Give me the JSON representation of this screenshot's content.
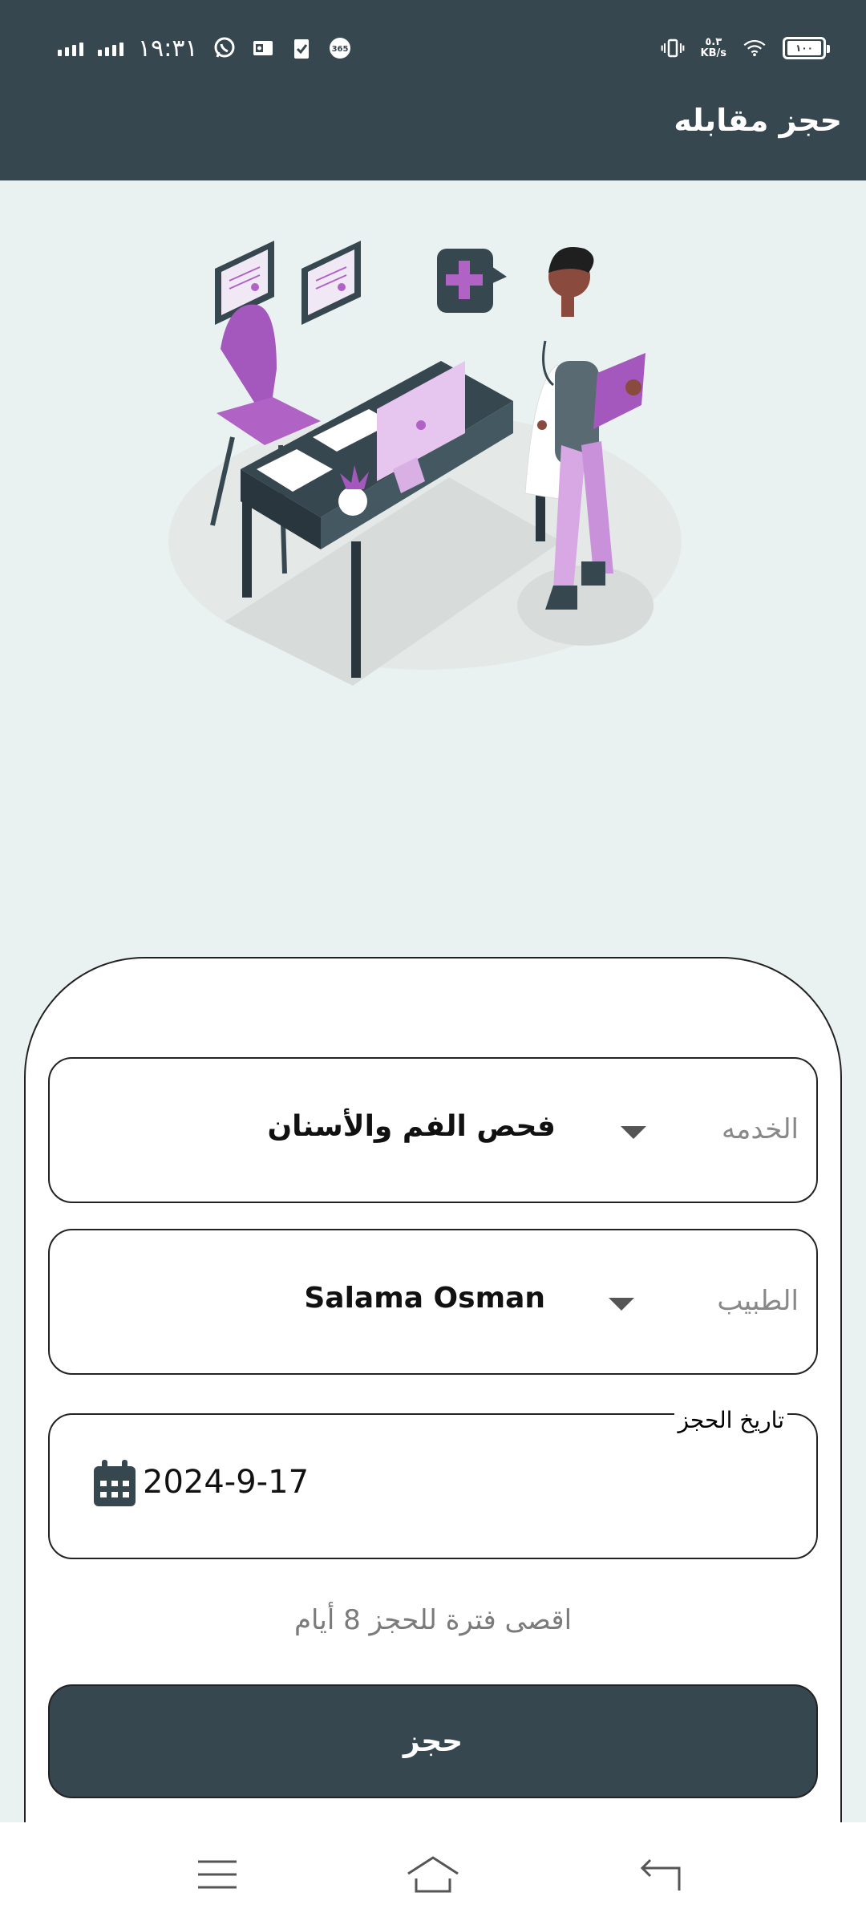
{
  "status_bar": {
    "time": "١٩:٣١",
    "net_speed_value": "٥.٣",
    "net_speed_unit": "KB/s",
    "battery": "١٠٠",
    "icons": [
      "signal-icon",
      "signal-icon",
      "whatsapp-icon",
      "outlook-icon",
      "task-icon",
      "app-365-icon",
      "vibrate-icon",
      "wifi-icon",
      "battery-icon"
    ]
  },
  "app_bar": {
    "title": "حجز مقابله"
  },
  "illustration": {
    "name": "doctor-office-illustration"
  },
  "form": {
    "service": {
      "label": "الخدمه",
      "value": "فحص الفم والأسنان"
    },
    "doctor": {
      "label": "الطبيب",
      "value": "Salama Osman"
    },
    "date": {
      "label": "تاريخ الحجز",
      "value": "2024-9-17"
    },
    "note": "اقصى فترة للحجز 8 أيام",
    "submit_label": "حجز"
  },
  "nav_bar": {
    "buttons": [
      "menu-icon",
      "home-icon",
      "back-icon"
    ]
  },
  "colors": {
    "primary": "#374750",
    "background": "#eaf2f1",
    "accent": "#b063c5"
  }
}
